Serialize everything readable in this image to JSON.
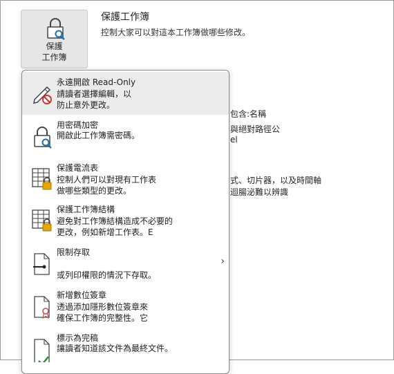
{
  "protect_button": {
    "line1": "保護",
    "line2": "工作簿"
  },
  "header": {
    "title": "保護工作簿",
    "description": "控制大家可以對這本工作簿做哪些修改。"
  },
  "background": {
    "line1": "包含:名稱",
    "line2": "與絕對路徑公",
    "line3": "el",
    "line4": "式、切片器，以及時間軸",
    "line5": "迴腸泌難以辨識"
  },
  "menu": {
    "items": [
      {
        "title": "永遠開啟 Read-Only",
        "desc1": "請讀者選擇編輯，以",
        "desc2": "防止意外更改。",
        "icon": "pencil-no-icon"
      },
      {
        "title": "用密碼加密",
        "desc1": "開啟此工作簿需密碼。",
        "desc2": "",
        "icon": "lock-search-icon"
      },
      {
        "title": "保護電流表",
        "desc1": "控制人們可以對現有工作表",
        "desc2": "做哪些類型的更改。",
        "icon": "sheet-lock-icon"
      },
      {
        "title": "保護工作簿結構",
        "desc1": "避免對工作簿結構造成不必要的",
        "desc2": "更改，例如新增工作表。E",
        "icon": "workbook-lock-icon"
      },
      {
        "title": "限制存取",
        "desc1": "",
        "desc2": "或列印權限的情況下存取。",
        "icon": "restricted-doc-icon",
        "chevron": "›"
      },
      {
        "title": "新增數位簽章",
        "desc1": "透過添加隱形數位簽章來",
        "desc2": "確保工作簿的完整性。它",
        "icon": "signature-icon"
      },
      {
        "title": "標示為完稿",
        "desc1": "讓讀者知道該文件為最終文件。",
        "desc2": "",
        "icon": "final-doc-icon"
      }
    ]
  },
  "colors": {
    "hover": "#ececec",
    "lock": "#e8a700",
    "no_sign": "#d13438",
    "check": "#2e8b3a"
  }
}
